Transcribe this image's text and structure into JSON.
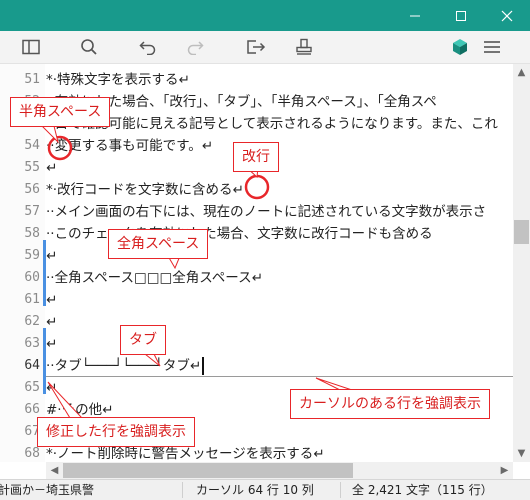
{
  "window": {
    "controls": {
      "minimize": "minimize-icon",
      "maximize": "maximize-icon",
      "close": "close-icon"
    },
    "accent": "#189a8c"
  },
  "toolbar": {
    "icons": [
      "sidebar-toggle-icon",
      "search-icon",
      "undo-icon",
      "redo-icon",
      "export-icon",
      "stamp-icon",
      "app-cube-icon",
      "hamburger-menu-icon"
    ]
  },
  "editor": {
    "lines": [
      {
        "number": "51",
        "text": "*·特殊文字を表示する↵"
      },
      {
        "number": "52",
        "text": "··有効にした場合、「改行」、「タブ」、「半角スペース」、「全角スペ"
      },
      {
        "number": "53",
        "text": "··目で確認可能に見える記号として表示されるようになります。また、これ"
      },
      {
        "number": "54",
        "text": "··変更する事も可能です。↵"
      },
      {
        "number": "55",
        "text": "↵"
      },
      {
        "number": "56",
        "text": "*·改行コードを文字数に含める↵"
      },
      {
        "number": "57",
        "text": "··メイン画面の右下には、現在のノートに記述されている文字数が表示さ"
      },
      {
        "number": "58",
        "text": "··このチェックを有効にした場合、文字数に改行コードも含める"
      },
      {
        "number": "59",
        "text": "↵"
      },
      {
        "number": "60",
        "text": "··全角スペース□□□全角スペース↵"
      },
      {
        "number": "61",
        "text": "↵"
      },
      {
        "number": "62",
        "text": "↵"
      },
      {
        "number": "63",
        "text": "↵"
      },
      {
        "number": "64",
        "text": "··タブ└───┘└───┘タブ↵"
      },
      {
        "number": "65",
        "text": "↵"
      },
      {
        "number": "66",
        "text": "#·その他↵"
      },
      {
        "number": "67",
        "text": "↵"
      },
      {
        "number": "68",
        "text": "*·ノート削除時に警告メッセージを表示する↵"
      }
    ]
  },
  "status": {
    "left": "計画か－埼玉県警",
    "cursor": "カーソル 64 行 10 列",
    "count": "全 2,421 文字（115 行）"
  },
  "callouts": {
    "half_space": "半角スペース",
    "newline": "改行",
    "full_space": "全角スペース",
    "tab": "タブ",
    "cursor_line": "カーソルのある行を強調表示",
    "modified_line": "修正した行を強調表示",
    "color": "#e8262a"
  }
}
